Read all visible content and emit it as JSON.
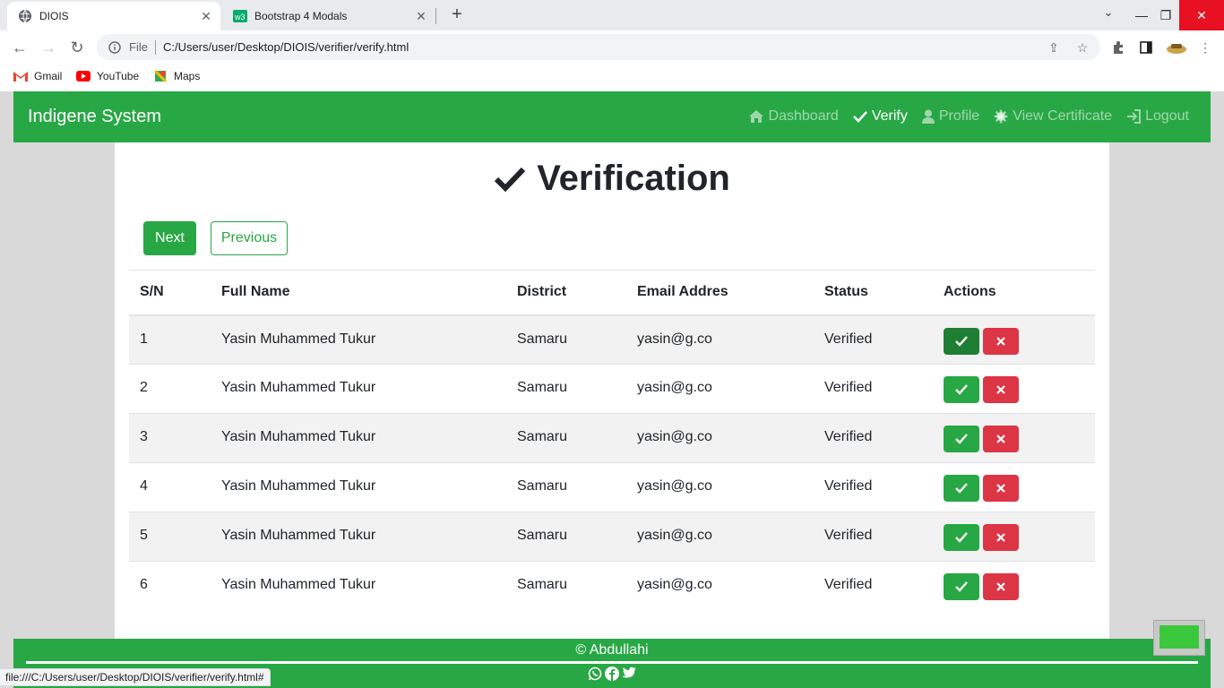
{
  "browser": {
    "tabs": [
      {
        "title": "DIOIS",
        "active": true
      },
      {
        "title": "Bootstrap 4 Modals",
        "active": false
      }
    ],
    "address": {
      "protocol": "File",
      "url": "C:/Users/user/Desktop/DIOIS/verifier/verify.html"
    },
    "bookmarks": [
      "Gmail",
      "YouTube",
      "Maps"
    ],
    "status_url": "file:///C:/Users/user/Desktop/DIOIS/verifier/verify.html#"
  },
  "navbar": {
    "brand": "Indigene System",
    "links": [
      {
        "label": "Dashboard",
        "icon": "home-icon",
        "active": false
      },
      {
        "label": "Verify",
        "icon": "check-icon",
        "active": true
      },
      {
        "label": "Profile",
        "icon": "user-icon",
        "active": false
      },
      {
        "label": "View Certificate",
        "icon": "certificate-icon",
        "active": false
      },
      {
        "label": "Logout",
        "icon": "sign-in-icon",
        "active": false
      }
    ]
  },
  "page": {
    "heading": "Verification",
    "next_label": "Next",
    "previous_label": "Previous"
  },
  "table": {
    "headers": [
      "S/N",
      "Full Name",
      "District",
      "Email Addres",
      "Status",
      "Actions"
    ],
    "rows": [
      {
        "sn": "1",
        "name": "Yasin Muhammed Tukur",
        "district": "Samaru",
        "email": "yasin@g.co",
        "status": "Verified"
      },
      {
        "sn": "2",
        "name": "Yasin Muhammed Tukur",
        "district": "Samaru",
        "email": "yasin@g.co",
        "status": "Verified"
      },
      {
        "sn": "3",
        "name": "Yasin Muhammed Tukur",
        "district": "Samaru",
        "email": "yasin@g.co",
        "status": "Verified"
      },
      {
        "sn": "4",
        "name": "Yasin Muhammed Tukur",
        "district": "Samaru",
        "email": "yasin@g.co",
        "status": "Verified"
      },
      {
        "sn": "5",
        "name": "Yasin Muhammed Tukur",
        "district": "Samaru",
        "email": "yasin@g.co",
        "status": "Verified"
      },
      {
        "sn": "6",
        "name": "Yasin Muhammed Tukur",
        "district": "Samaru",
        "email": "yasin@g.co",
        "status": "Verified"
      }
    ]
  },
  "footer": {
    "copyright": "© Abdullahi",
    "social": [
      "whatsapp-icon",
      "facebook-icon",
      "twitter-icon"
    ]
  },
  "colors": {
    "primary": "#28a745",
    "danger": "#dc3545",
    "background": "#d9d9d9"
  }
}
